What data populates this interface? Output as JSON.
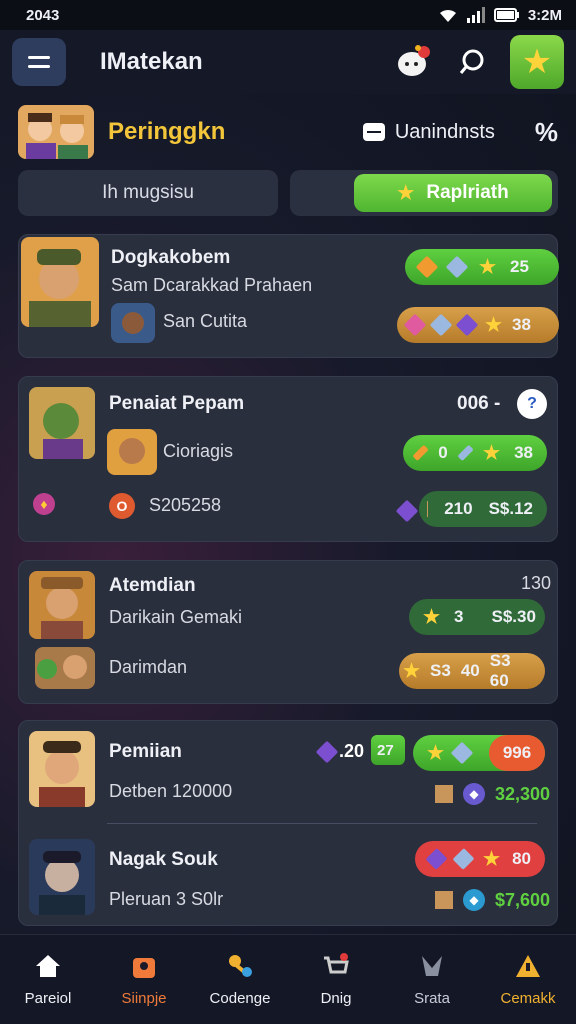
{
  "status": {
    "time": "2043",
    "clock": "3:2M"
  },
  "header": {
    "title": "IMatekan"
  },
  "section": {
    "title": "Peringgkn",
    "units_label": "Uanindnsts"
  },
  "tabs": [
    {
      "label": "Ih mugsisu"
    },
    {
      "label": "Raplriath"
    }
  ],
  "cards": [
    {
      "name": "Dogkakobem",
      "line2": "Sam Dcarakkad Prahaen",
      "line3": "San Cutita",
      "badge1_value": "25",
      "badge2_value": "38"
    },
    {
      "name": "Penaiat Pepam",
      "score": "006 -",
      "line2": "Cioriagis",
      "line3": "S205258",
      "badge1_a": "0",
      "badge1_b": "38",
      "badge2_a": "210",
      "badge2_b": "S$.12"
    },
    {
      "name": "Atemdian",
      "score": "130",
      "line2": "Darikain Gemaki",
      "line3": "Darimdan",
      "badge1_a": "3",
      "badge1_b": "S$.30",
      "badge2_a": "S3",
      "badge2_b": "40",
      "badge2_c": "S3 60"
    },
    {
      "name": "Pemiian",
      "line2": "Detben 120000",
      "gem_value": ".20",
      "small_badge": "27",
      "badge1_value": "996",
      "total": "32,300"
    },
    {
      "name": "Nagak Souk",
      "line2": "Pleruan 3 S0lr",
      "badge1_value": "80",
      "total": "$7,600"
    }
  ],
  "nav": [
    {
      "label": "Pareiol",
      "icon": "home-icon",
      "color": "#ffffff"
    },
    {
      "label": "Siinpje",
      "icon": "bag-icon",
      "color": "#f07a3a"
    },
    {
      "label": "Codenge",
      "icon": "keys-icon",
      "color": "#ffffff"
    },
    {
      "label": "Dnig",
      "icon": "cart-icon",
      "color": "#ffffff"
    },
    {
      "label": "Srata",
      "icon": "stats-icon",
      "color": "#c8ccd8"
    },
    {
      "label": "Cemakk",
      "icon": "warning-icon",
      "color": "#f0b030"
    }
  ]
}
